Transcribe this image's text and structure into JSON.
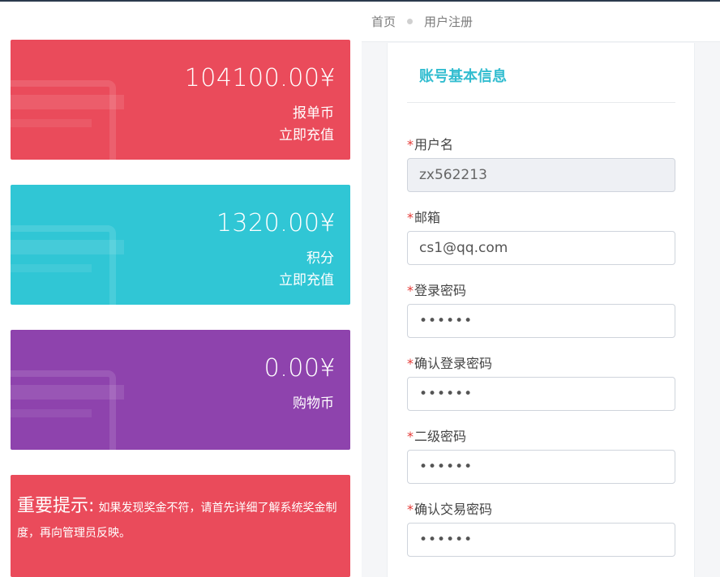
{
  "breadcrumb": {
    "home": "首页",
    "current": "用户注册"
  },
  "cards": [
    {
      "amount": "104100.00¥",
      "label": "报单币",
      "action": "立即充值",
      "color": "#ea4b5b"
    },
    {
      "amount": "1320.00¥",
      "label": "积分",
      "action": "立即充值",
      "color": "#30c6d5"
    },
    {
      "amount": "0.00¥",
      "label": "购物币",
      "color": "#8e43ad"
    }
  ],
  "notice": {
    "title": "重要提示:",
    "text": "如果发现奖金不符，请首先详细了解系统奖金制度，再向管理员反映。"
  },
  "form": {
    "title": "账号基本信息",
    "required_mark": "*",
    "fields": [
      {
        "label": "用户名",
        "value": "zx562213"
      },
      {
        "label": "邮箱",
        "value": "cs1@qq.com"
      },
      {
        "label": "登录密码",
        "value": "••••••"
      },
      {
        "label": "确认登录密码",
        "value": "••••••"
      },
      {
        "label": "二级密码",
        "value": "••••••"
      },
      {
        "label": "确认交易密码",
        "value": "••••••"
      }
    ]
  },
  "colors": {
    "accent_title": "#33bdd0",
    "required": "#e53935"
  }
}
